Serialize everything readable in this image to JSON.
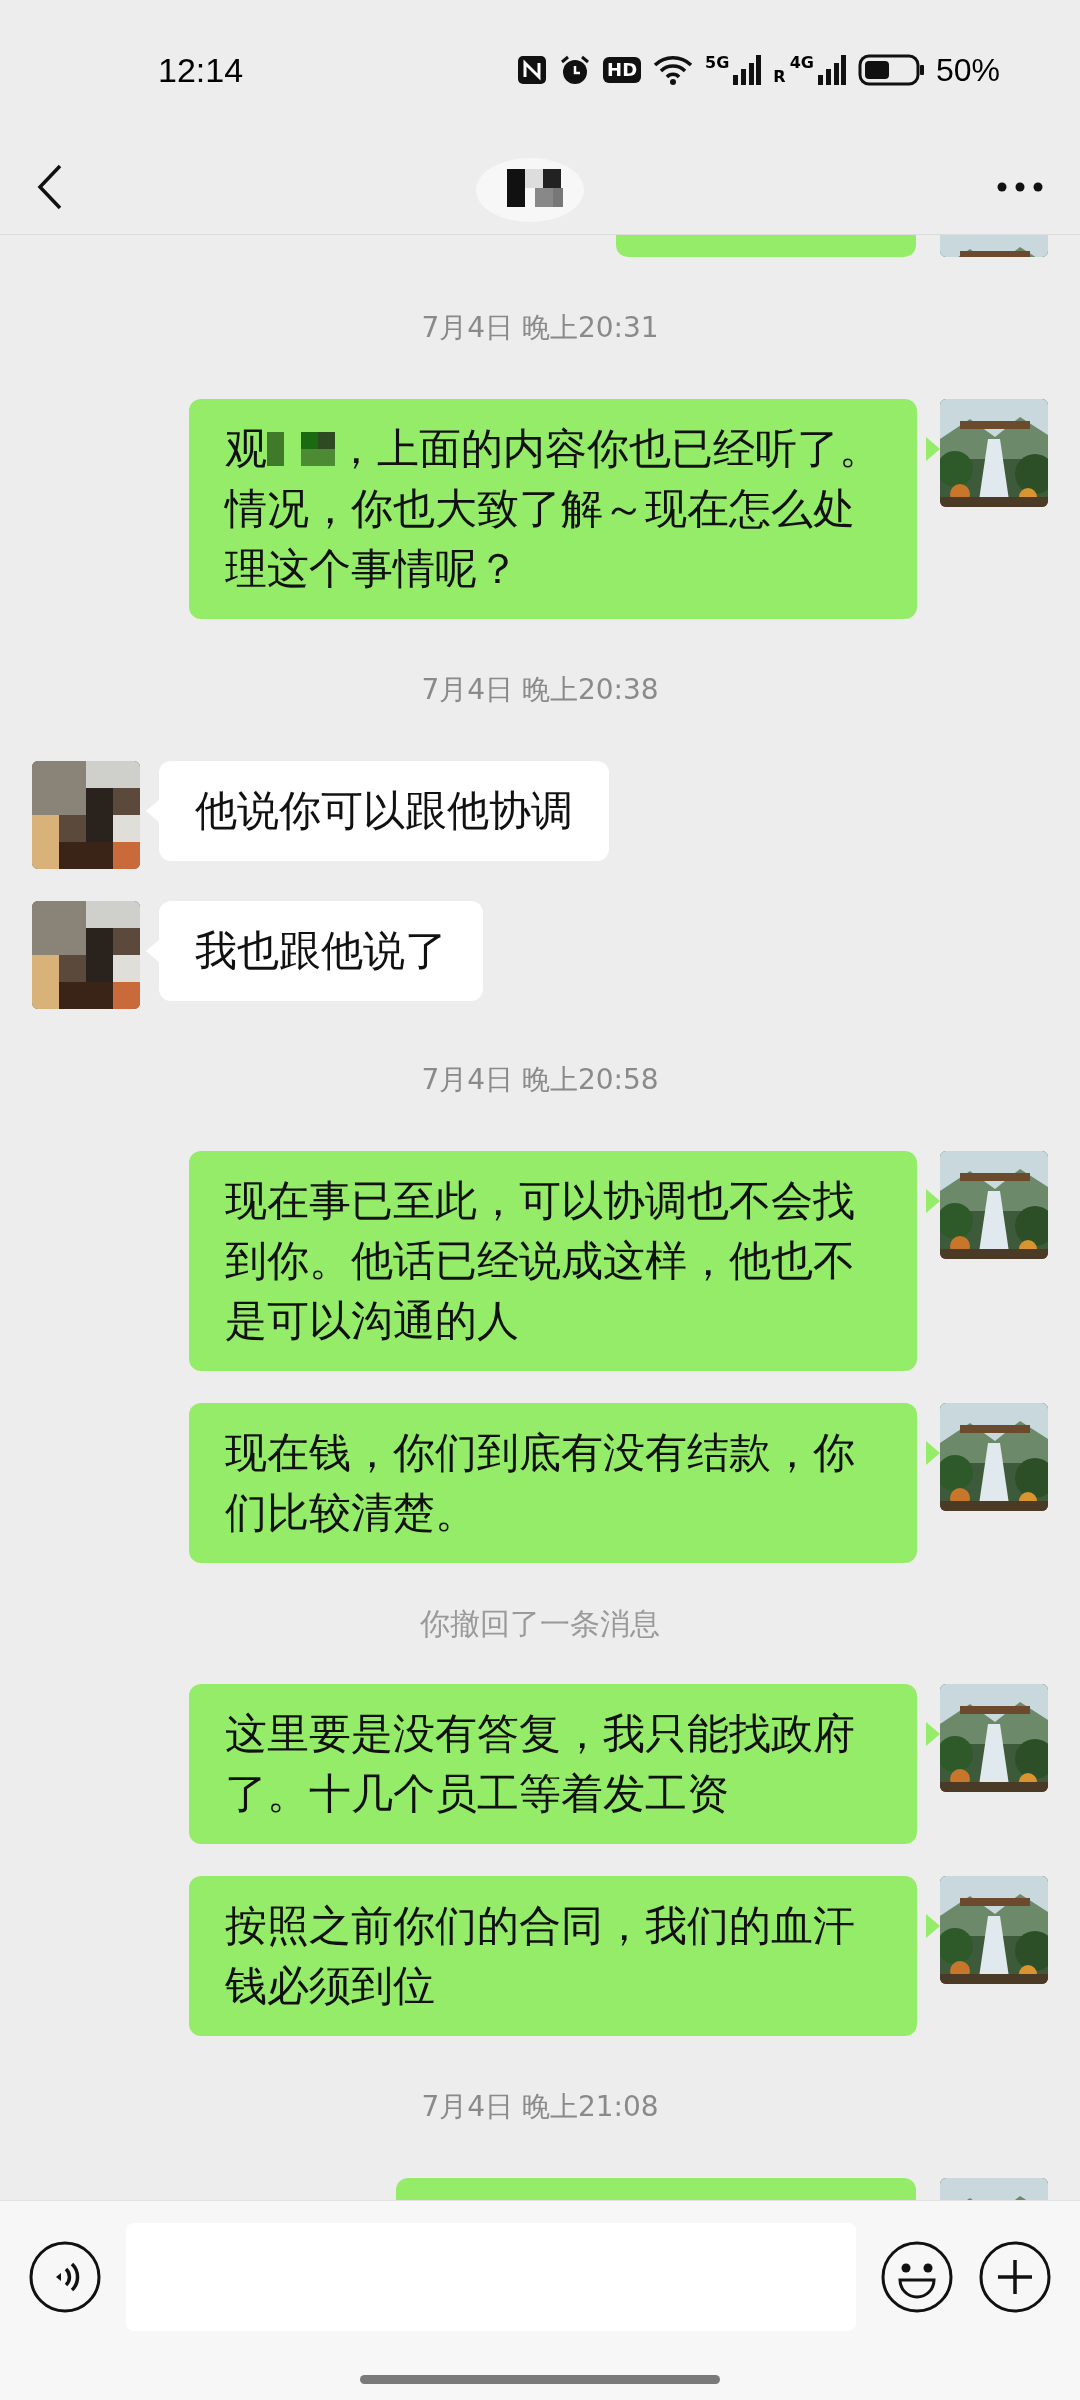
{
  "status_bar": {
    "time": "12:14",
    "signal_1": "5G",
    "signal_2": "4G",
    "roaming": "R",
    "hd": "HD",
    "battery": "50%"
  },
  "messages": [
    {
      "kind": "partial",
      "mine": true
    },
    {
      "kind": "time",
      "text": "7月4日 晚上20:31"
    },
    {
      "kind": "text",
      "mine": true,
      "prefix": "观",
      "redacted": true,
      "text": "，上面的内容你也已经听了。",
      "more": "情况，你也大致了解～现在怎么处理这个事情呢？"
    },
    {
      "kind": "time",
      "text": "7月4日 晚上20:38"
    },
    {
      "kind": "text",
      "mine": false,
      "text": "他说你可以跟他协调"
    },
    {
      "kind": "text",
      "mine": false,
      "text": "我也跟他说了"
    },
    {
      "kind": "time",
      "text": "7月4日 晚上20:58"
    },
    {
      "kind": "text",
      "mine": true,
      "text": "现在事已至此，可以协调也不会找到你。他话已经说成这样，他也不是可以沟通的人"
    },
    {
      "kind": "text",
      "mine": true,
      "text": "现在钱，你们到底有没有结款，你们比较清楚。"
    },
    {
      "kind": "notice",
      "text": "你撤回了一条消息"
    },
    {
      "kind": "text",
      "mine": true,
      "text": "这里要是没有答复，我只能找政府了。十几个员工等着发工资"
    },
    {
      "kind": "text",
      "mine": true,
      "text": "按照之前你们的合同，我们的血汗钱必须到位"
    },
    {
      "kind": "time",
      "text": "7月4日 晚上21:08"
    },
    {
      "kind": "partial",
      "mine": true
    }
  ]
}
